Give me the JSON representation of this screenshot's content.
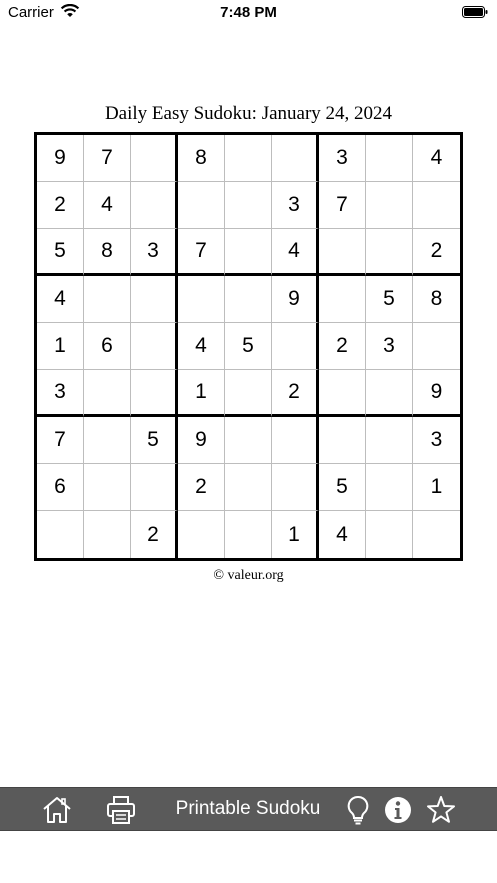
{
  "status_bar": {
    "carrier": "Carrier",
    "time": "7:48 PM"
  },
  "puzzle": {
    "title": "Daily Easy Sudoku: January 24,  2024",
    "grid": [
      [
        "9",
        "7",
        "",
        "8",
        "",
        "",
        "3",
        "",
        "4"
      ],
      [
        "2",
        "4",
        "",
        "",
        "",
        "3",
        "7",
        "",
        ""
      ],
      [
        "5",
        "8",
        "3",
        "7",
        "",
        "4",
        "",
        "",
        "2"
      ],
      [
        "4",
        "",
        "",
        "",
        "",
        "9",
        "",
        "5",
        "8"
      ],
      [
        "1",
        "6",
        "",
        "4",
        "5",
        "",
        "2",
        "3",
        ""
      ],
      [
        "3",
        "",
        "",
        "1",
        "",
        "2",
        "",
        "",
        "9"
      ],
      [
        "7",
        "",
        "5",
        "9",
        "",
        "",
        "",
        "",
        "3"
      ],
      [
        "6",
        "",
        "",
        "2",
        "",
        "",
        "5",
        "",
        "1"
      ],
      [
        "",
        "",
        "2",
        "",
        "",
        "1",
        "4",
        "",
        ""
      ]
    ],
    "copyright": "© valeur.org"
  },
  "toolbar": {
    "title": "Printable Sudoku",
    "icons": [
      "home-icon",
      "printer-icon",
      "lightbulb-icon",
      "info-icon",
      "star-icon"
    ]
  }
}
